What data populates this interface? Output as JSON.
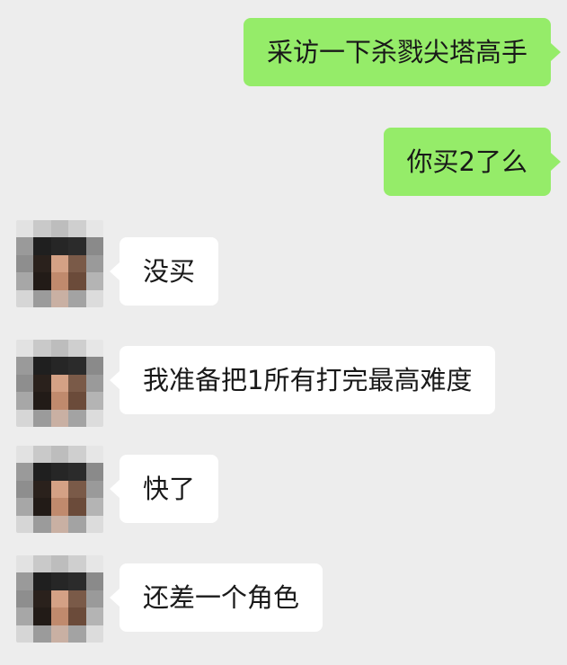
{
  "chat": {
    "messages": [
      {
        "sender": "me",
        "text": "采访一下杀戮尖塔高手"
      },
      {
        "sender": "me",
        "text": "你买2了么"
      },
      {
        "sender": "contact",
        "text": "没买"
      },
      {
        "sender": "contact",
        "text": "我准备把1所有打完最高难度"
      },
      {
        "sender": "contact",
        "text": "快了"
      },
      {
        "sender": "contact",
        "text": "还差一个角色"
      }
    ]
  },
  "colors": {
    "background": "#ededed",
    "outgoing_bubble": "#95ec69",
    "incoming_bubble": "#ffffff",
    "text": "#191919"
  },
  "avatar": {
    "icon": "pixelated-avatar-icon",
    "style": "mosaic"
  }
}
